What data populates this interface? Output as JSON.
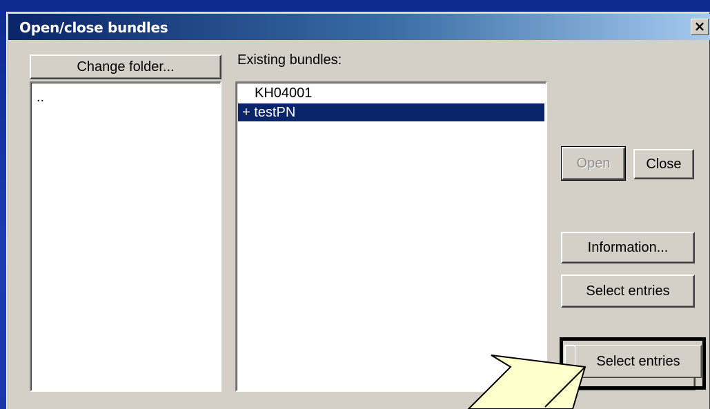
{
  "window": {
    "title": "Open/close bundles"
  },
  "buttons": {
    "change_folder": "Change folder...",
    "open": "Open",
    "close": "Close",
    "information": "Information...",
    "select_entries": "Select entries",
    "select_entries_highlighted": "Select entries"
  },
  "labels": {
    "existing_bundles": "Existing bundles:"
  },
  "folder_list": {
    "items": [
      ".."
    ]
  },
  "bundle_list": {
    "items": [
      {
        "label": "KH04001",
        "selected": false
      },
      {
        "label": "+ testPN",
        "selected": true
      }
    ]
  },
  "colors": {
    "background": "#1a37a8",
    "dialog": "#d4d0c8",
    "selection": "#0a246a",
    "callout_arrow": "#ffffcc"
  },
  "icons": {
    "close": "close-x-icon",
    "arrow": "callout-arrow-icon"
  }
}
